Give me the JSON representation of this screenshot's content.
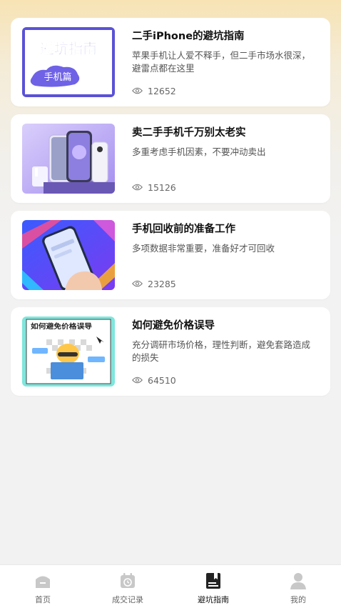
{
  "articles": [
    {
      "title": "二手iPhone的避坑指南",
      "description": "苹果手机让人爱不释手，但二手市场水很深，避雷点都在这里",
      "views": "12652",
      "thumb_title": "避坑指南",
      "thumb_subtitle": "手机篇"
    },
    {
      "title": "卖二手手机千万别太老实",
      "description": "多重考虑手机因素，不要冲动卖出",
      "views": "15126"
    },
    {
      "title": "手机回收前的准备工作",
      "description": "多项数据非常重要，准备好才可回收",
      "views": "23285"
    },
    {
      "title": "如何避免价格误导",
      "description": "充分调研市场价格，理性判断，避免套路造成的损失",
      "views": "64510",
      "thumb_title": "如何避免价格误导"
    }
  ],
  "tabbar": {
    "items": [
      {
        "label": "首页",
        "icon": "home-icon"
      },
      {
        "label": "成交记录",
        "icon": "calendar-clock-icon"
      },
      {
        "label": "避坑指南",
        "icon": "guide-book-icon",
        "active": true
      },
      {
        "label": "我的",
        "icon": "user-icon"
      }
    ]
  },
  "colors": {
    "active_icon": "#222222",
    "inactive_icon": "#c8c8c8",
    "thumb_border": "#5a52d6"
  }
}
